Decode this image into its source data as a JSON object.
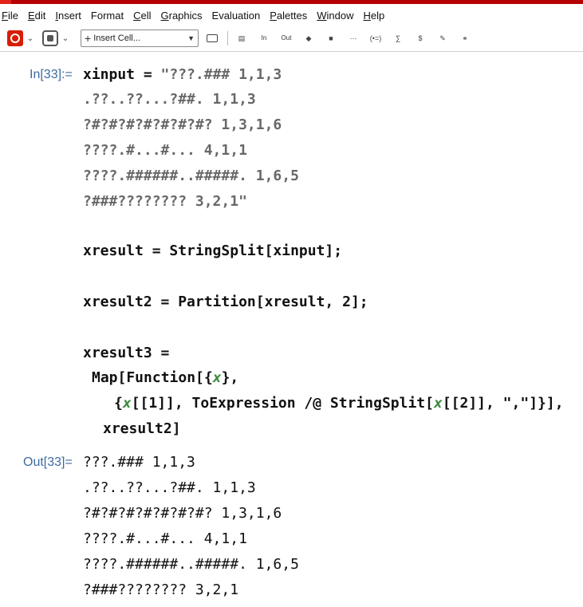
{
  "window": {
    "accent_color": "#b50000"
  },
  "menubar": {
    "items": [
      {
        "mnemonic": "F",
        "rest": "ile"
      },
      {
        "mnemonic": "E",
        "rest": "dit"
      },
      {
        "mnemonic": "I",
        "rest": "nsert"
      },
      {
        "mnemonic": "",
        "rest": "Format"
      },
      {
        "mnemonic": "C",
        "rest": "ell"
      },
      {
        "mnemonic": "G",
        "rest": "raphics"
      },
      {
        "mnemonic": "",
        "rest": "Evaluation"
      },
      {
        "mnemonic": "P",
        "rest": "alettes"
      },
      {
        "mnemonic": "W",
        "rest": "indow"
      },
      {
        "mnemonic": "H",
        "rest": "elp"
      }
    ]
  },
  "toolbar": {
    "cell_style_label": "Insert Cell...",
    "in_label": "In",
    "out_label": "Out",
    "icons": [
      "mathematica-icon",
      "gear-icon",
      "insert-cell-dropdown",
      "cell-bracket-icon",
      "input-icon",
      "output-icon",
      "evaluate-icon",
      "stop-icon",
      "more-icon",
      "template-icon",
      "sum-icon",
      "tex-icon",
      "pen-icon",
      "link-icon"
    ]
  },
  "notebook": {
    "in_label": "In[33]:=",
    "out_label": "Out[33]=",
    "input_lines": [
      {
        "id": "l1",
        "parts": [
          {
            "t": "xinput",
            "c": "plain"
          },
          {
            "t": " = ",
            "c": "plain"
          },
          {
            "t": "\"???.### 1,1,3",
            "c": "str"
          }
        ]
      },
      {
        "id": "l2",
        "parts": [
          {
            "t": ".??..??...?##. 1,1,3",
            "c": "str"
          }
        ]
      },
      {
        "id": "l3",
        "parts": [
          {
            "t": "?#?#?#?#?#?#?#? 1,3,1,6",
            "c": "str"
          }
        ]
      },
      {
        "id": "l4",
        "parts": [
          {
            "t": "????.#...#... 4,1,1",
            "c": "str"
          }
        ]
      },
      {
        "id": "l5",
        "parts": [
          {
            "t": "????.######..#####. 1,6,5",
            "c": "str"
          }
        ]
      },
      {
        "id": "l6",
        "parts": [
          {
            "t": "?###???????? 3,2,1\"",
            "c": "str"
          }
        ]
      },
      {
        "id": "l7",
        "parts": [
          {
            "t": "xresult = StringSplit[xinput];",
            "c": "plain"
          }
        ]
      },
      {
        "id": "l8",
        "parts": [
          {
            "t": "xresult2 = Partition[xresult, 2];",
            "c": "plain"
          }
        ]
      },
      {
        "id": "l9",
        "parts": [
          {
            "t": "xresult3 =",
            "c": "plain"
          }
        ]
      },
      {
        "id": "l10",
        "parts": [
          {
            "t": "Map[Function[{",
            "c": "plain"
          },
          {
            "t": "x",
            "c": "var"
          },
          {
            "t": "},",
            "c": "plain"
          }
        ]
      },
      {
        "id": "l11",
        "parts": [
          {
            "t": "{",
            "c": "plain"
          },
          {
            "t": "x",
            "c": "var"
          },
          {
            "t": "[[1]], ToExpression /@ StringSplit[",
            "c": "plain"
          },
          {
            "t": "x",
            "c": "var"
          },
          {
            "t": "[[2]], \",\"]}],",
            "c": "plain"
          }
        ]
      },
      {
        "id": "l12",
        "parts": [
          {
            "t": "xresult2]",
            "c": "plain"
          }
        ]
      }
    ],
    "output_lines": [
      "???.### 1,1,3",
      ".??..??...?##. 1,1,3",
      "?#?#?#?#?#?#?#? 1,3,1,6",
      "????.#...#... 4,1,1",
      "????.######..#####. 1,6,5",
      "?###???????? 3,2,1"
    ]
  },
  "colors": {
    "label": "#3e6c9e",
    "string": "#686868",
    "variable": "#3e8a3e"
  }
}
